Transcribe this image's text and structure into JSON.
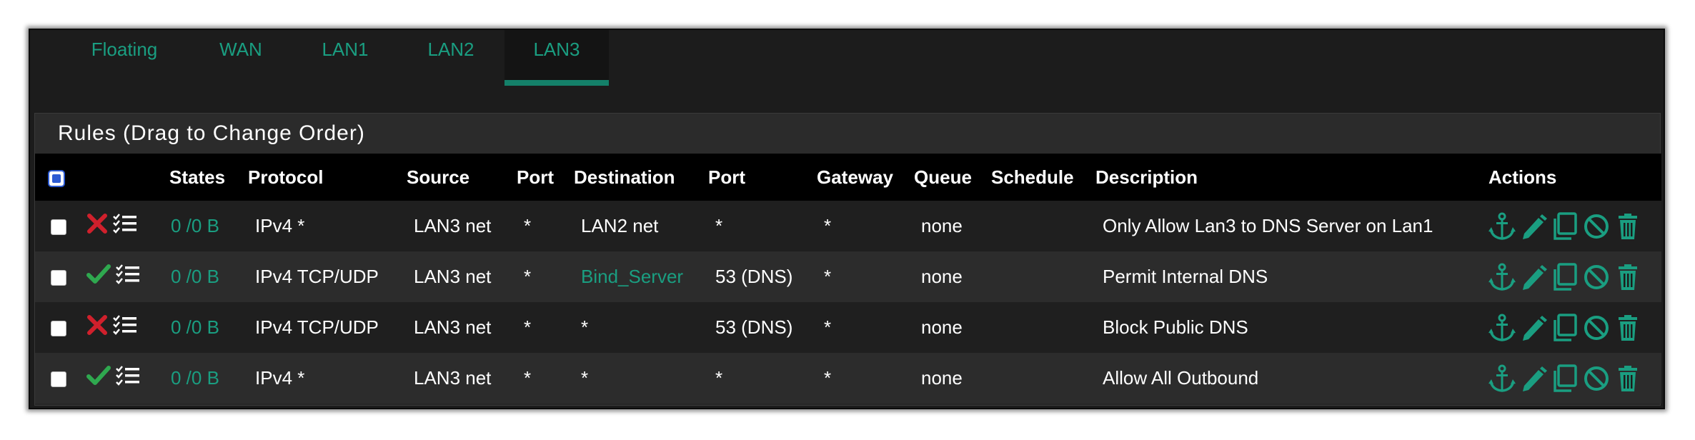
{
  "tabs": [
    {
      "label": "Floating"
    },
    {
      "label": "WAN"
    },
    {
      "label": "LAN1"
    },
    {
      "label": "LAN2"
    },
    {
      "label": "LAN3",
      "active": true
    }
  ],
  "panel": {
    "title": "Rules (Drag to Change Order)"
  },
  "columns": {
    "states": "States",
    "protocol": "Protocol",
    "source": "Source",
    "port": "Port",
    "destination": "Destination",
    "dest_port": "Port",
    "gateway": "Gateway",
    "queue": "Queue",
    "schedule": "Schedule",
    "description": "Description",
    "actions": "Actions"
  },
  "rules": [
    {
      "action": "block",
      "states": "0 /0 B",
      "protocol": "IPv4 *",
      "source": "LAN3 net",
      "port": "*",
      "destination": "LAN2 net",
      "dest_port": "*",
      "gateway": "*",
      "queue": "none",
      "schedule": "",
      "description": "Only Allow Lan3 to DNS Server on Lan1"
    },
    {
      "action": "pass",
      "states": "0 /0 B",
      "protocol": "IPv4 TCP/UDP",
      "source": "LAN3 net",
      "port": "*",
      "destination": "Bind_Server",
      "destination_is_link": true,
      "dest_port": "53 (DNS)",
      "gateway": "*",
      "queue": "none",
      "schedule": "",
      "description": "Permit Internal DNS"
    },
    {
      "action": "block",
      "states": "0 /0 B",
      "protocol": "IPv4 TCP/UDP",
      "source": "LAN3 net",
      "port": "*",
      "destination": "*",
      "dest_port": "53 (DNS)",
      "gateway": "*",
      "queue": "none",
      "schedule": "",
      "description": "Block Public DNS"
    },
    {
      "action": "pass",
      "states": "0 /0 B",
      "protocol": "IPv4 *",
      "source": "LAN3 net",
      "port": "*",
      "destination": "*",
      "dest_port": "*",
      "gateway": "*",
      "queue": "none",
      "schedule": "",
      "description": "Allow All Outbound"
    }
  ],
  "icons": {
    "block": "x-icon",
    "pass": "check-icon",
    "log": "list-icon",
    "actions": [
      "anchor-icon",
      "pencil-icon",
      "copy-icon",
      "disable-icon",
      "trash-icon"
    ]
  },
  "colors": {
    "accent": "#1a9e81",
    "block": "#d0202c",
    "pass": "#2fa84f",
    "header_bg": "#000000"
  }
}
